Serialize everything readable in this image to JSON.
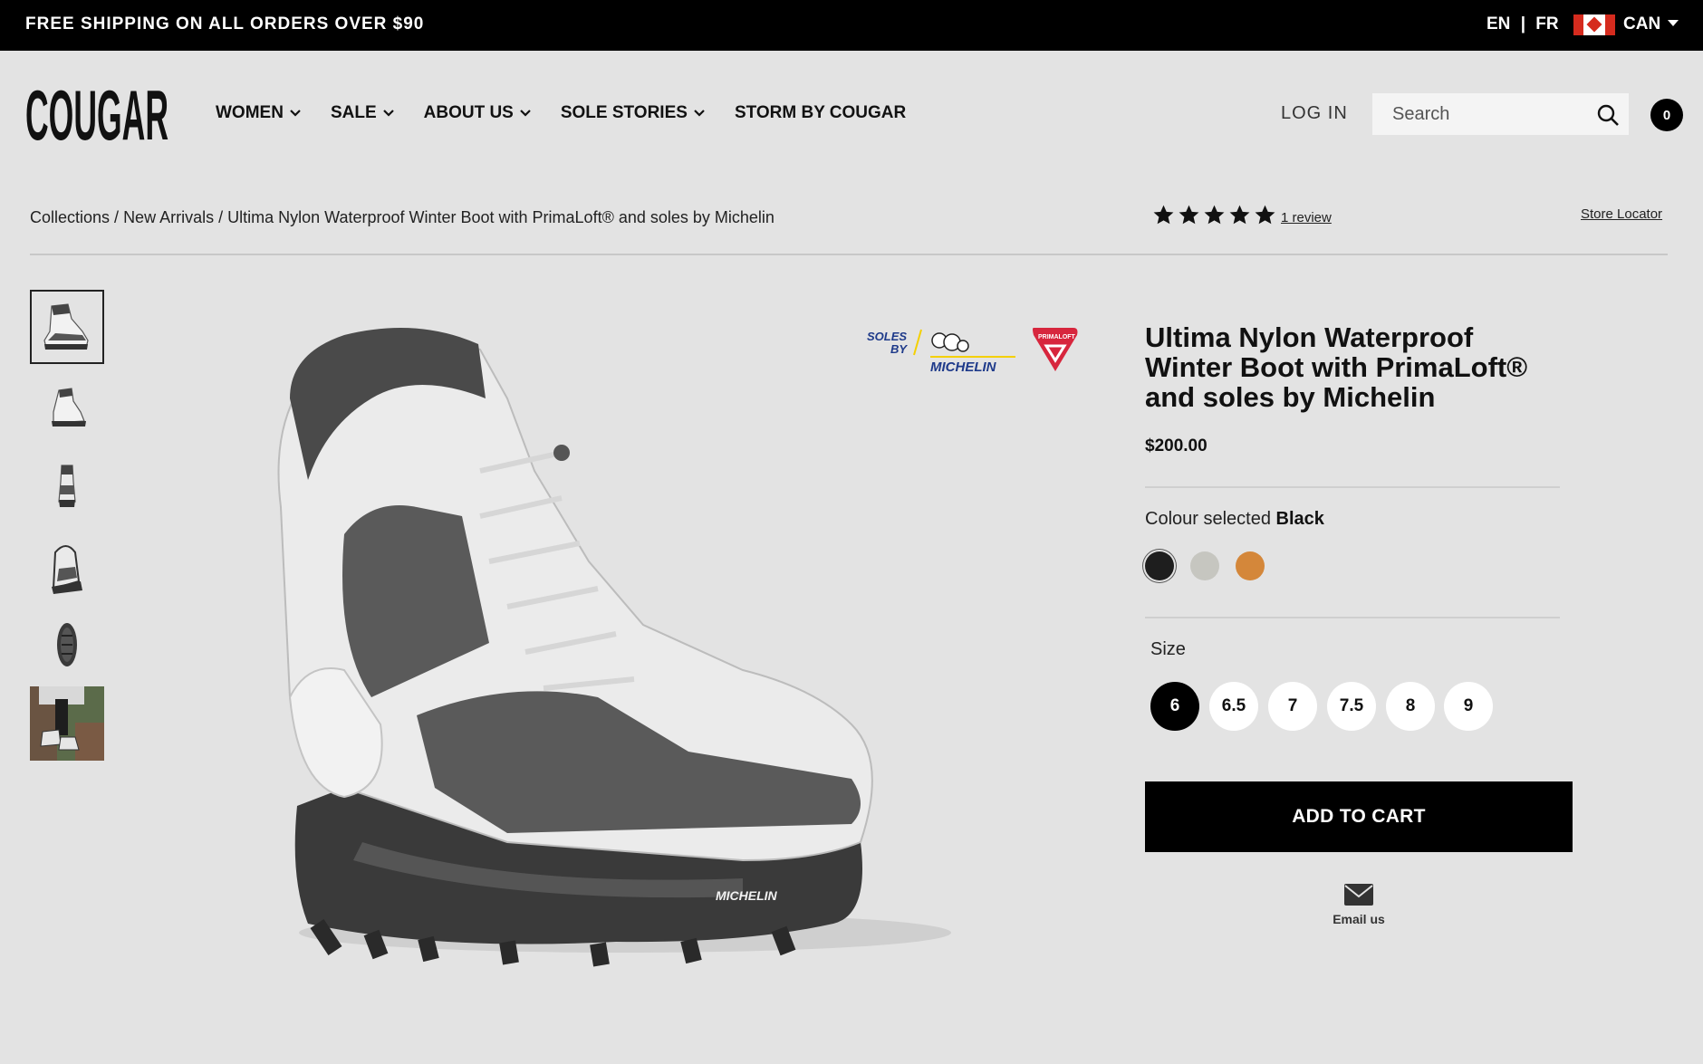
{
  "topbar": {
    "promo": "FREE SHIPPING ON ALL ORDERS OVER $90",
    "lang_en": "EN",
    "lang_sep": "|",
    "lang_fr": "FR",
    "country": "CAN"
  },
  "header": {
    "logo_text": "COUGAR",
    "nav": [
      {
        "label": "WOMEN",
        "dropdown": true
      },
      {
        "label": "SALE",
        "dropdown": true
      },
      {
        "label": "ABOUT US",
        "dropdown": true
      },
      {
        "label": "SOLE STORIES",
        "dropdown": true
      },
      {
        "label": "STORM BY COUGAR",
        "dropdown": false
      }
    ],
    "login": "LOG IN",
    "search_placeholder": "Search",
    "cart_count": "0"
  },
  "breadcrumb": {
    "items": [
      "Collections",
      "New Arrivals",
      "Ultima Nylon Waterproof Winter Boot with PrimaLoft® and soles by Michelin"
    ],
    "separator": "/"
  },
  "rating": {
    "stars": 5,
    "max": 5,
    "review_link": "1 review"
  },
  "store_locator": "Store Locator",
  "brand_badges": {
    "soles_by": "SOLES BY",
    "michelin": "MICHELIN",
    "primaloft": "PRIMALOFT"
  },
  "product": {
    "title": "Ultima Nylon Waterproof Winter Boot with PrimaLoft® and soles by Michelin",
    "price": "$200.00",
    "colour_label": "Colour selected",
    "colour_selected": "Black",
    "colours": [
      {
        "name": "Black",
        "hex": "#1e1e1e",
        "selected": true
      },
      {
        "name": "Grey",
        "hex": "#c6c6c0",
        "selected": false
      },
      {
        "name": "Orange",
        "hex": "#d4873a",
        "selected": false
      }
    ],
    "size_label": "Size",
    "sizes": [
      {
        "label": "6",
        "selected": true
      },
      {
        "label": "6.5",
        "selected": false
      },
      {
        "label": "7",
        "selected": false
      },
      {
        "label": "7.5",
        "selected": false
      },
      {
        "label": "8",
        "selected": false
      },
      {
        "label": "9",
        "selected": false
      }
    ],
    "add_to_cart": "ADD TO CART",
    "email_us": "Email us"
  },
  "thumbnails": [
    {
      "view": "side-view",
      "active": true
    },
    {
      "view": "side-view-alt",
      "active": false
    },
    {
      "view": "front-view",
      "active": false
    },
    {
      "view": "back-view",
      "active": false
    },
    {
      "view": "sole-view",
      "active": false
    },
    {
      "view": "lifestyle",
      "active": false
    }
  ],
  "colors": {
    "background": "#e3e3e3",
    "topbar": "#000000",
    "button": "#000000"
  }
}
